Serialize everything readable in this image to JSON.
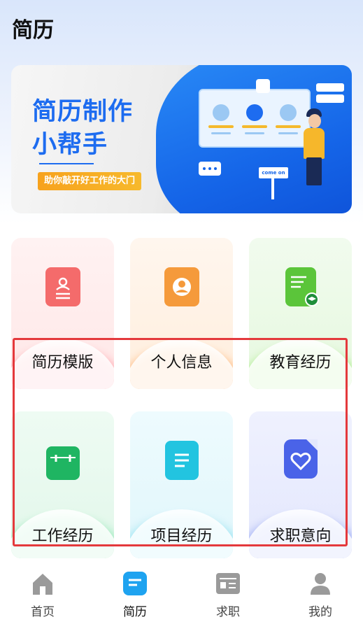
{
  "header": {
    "title": "简历"
  },
  "banner": {
    "title_line1": "简历制作",
    "title_line2": "小帮手",
    "subtitle": "助你敲开好工作的大门",
    "sign_text": "come on"
  },
  "tiles": [
    {
      "label": "简历模版",
      "icon": "resume-template-icon",
      "color": "#f46b6b"
    },
    {
      "label": "个人信息",
      "icon": "profile-card-icon",
      "color": "#f59a3b"
    },
    {
      "label": "教育经历",
      "icon": "education-doc-icon",
      "color": "#5bc53a"
    },
    {
      "label": "工作经历",
      "icon": "briefcase-bag-icon",
      "color": "#1fb562"
    },
    {
      "label": "项目经历",
      "icon": "project-list-icon",
      "color": "#22c4e0"
    },
    {
      "label": "求职意向",
      "icon": "heart-doc-icon",
      "color": "#4a63e8"
    }
  ],
  "nav": {
    "items": [
      {
        "label": "首页",
        "icon": "home-icon"
      },
      {
        "label": "简历",
        "icon": "resume-icon",
        "active": true
      },
      {
        "label": "求职",
        "icon": "job-search-icon"
      },
      {
        "label": "我的",
        "icon": "user-icon"
      }
    ]
  },
  "colors": {
    "accent": "#1d6cf0",
    "highlight_border": "#e4393c"
  }
}
